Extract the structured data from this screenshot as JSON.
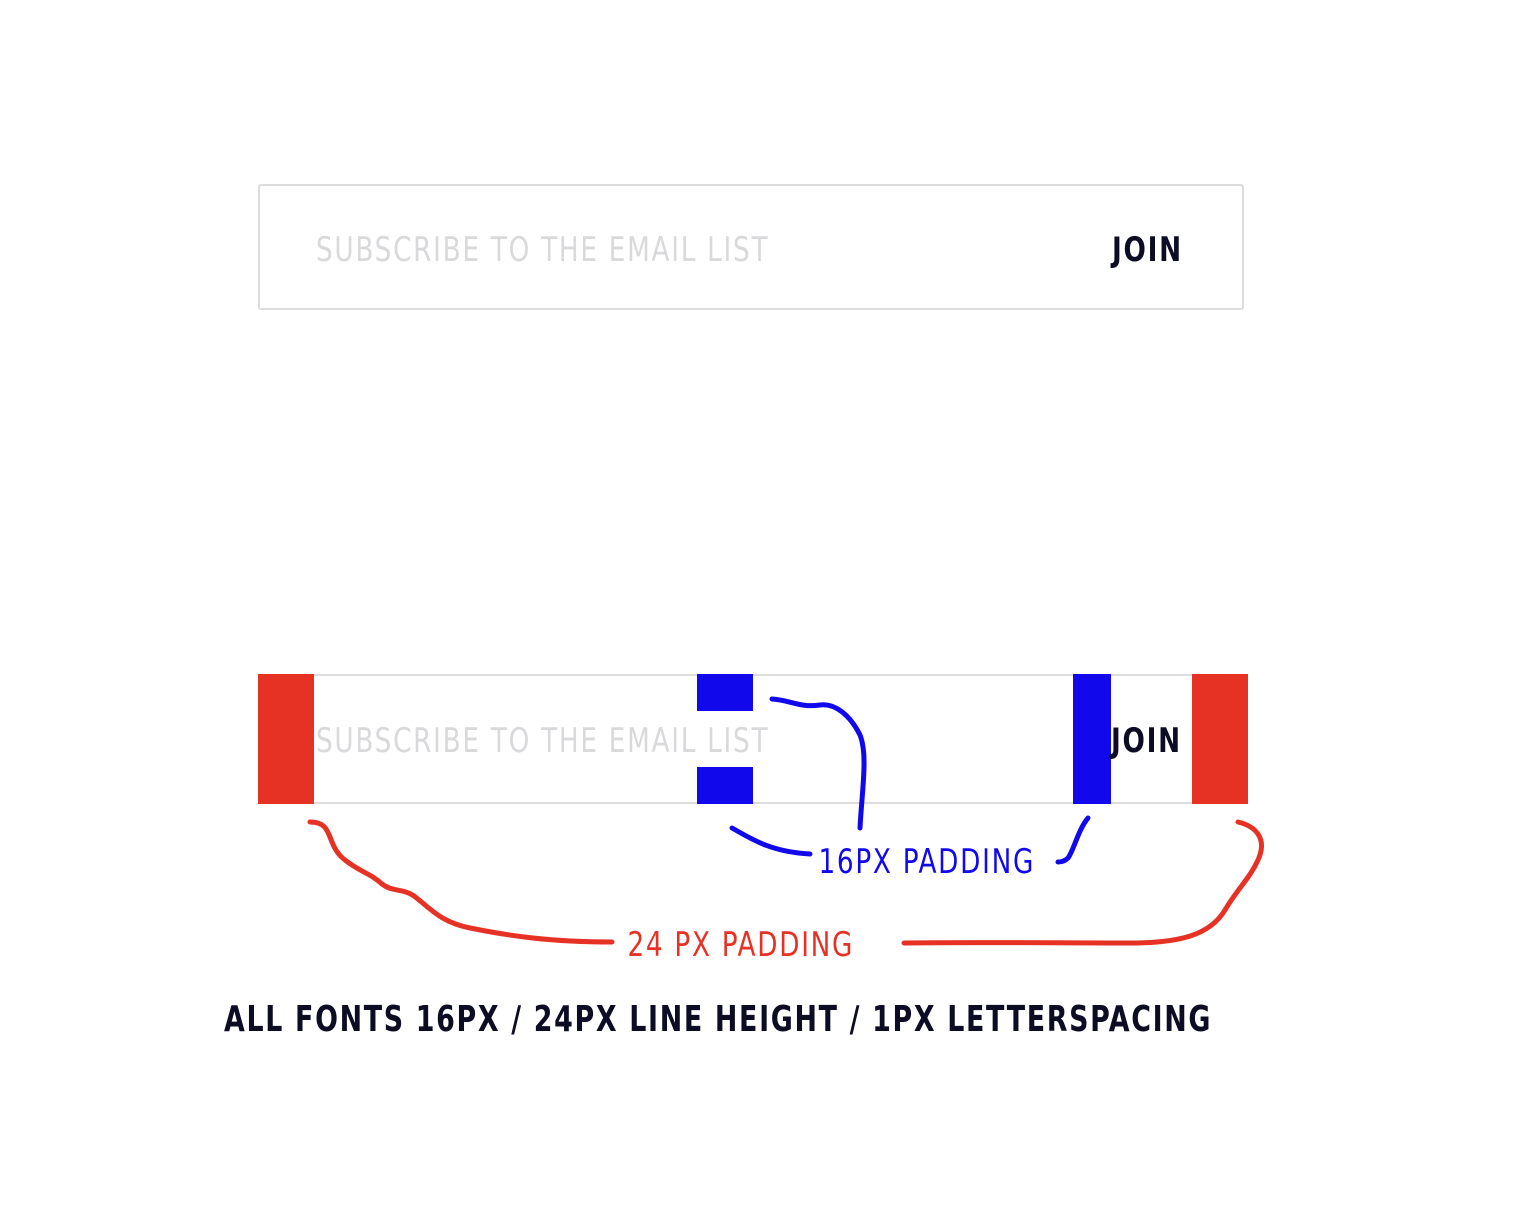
{
  "subscribe_form": {
    "placeholder": "SUBSCRIBE TO THE EMAIL LIST",
    "join_label": "JOIN"
  },
  "spec_diagram": {
    "placeholder": "SUBSCRIBE TO THE EMAIL LIST",
    "join_label": "JOIN",
    "inner_padding_label": "16PX PADDING",
    "outer_padding_label": "24 PX PADDING",
    "caption": "ALL FONTS 16PX / 24PX LINE HEIGHT / 1PX LETTERSPACING"
  },
  "colors": {
    "outer_padding": "#e63224",
    "inner_padding": "#1208ec",
    "text_dark": "#0c0d24",
    "placeholder": "#d9d9dc",
    "border": "#dcdcde"
  }
}
